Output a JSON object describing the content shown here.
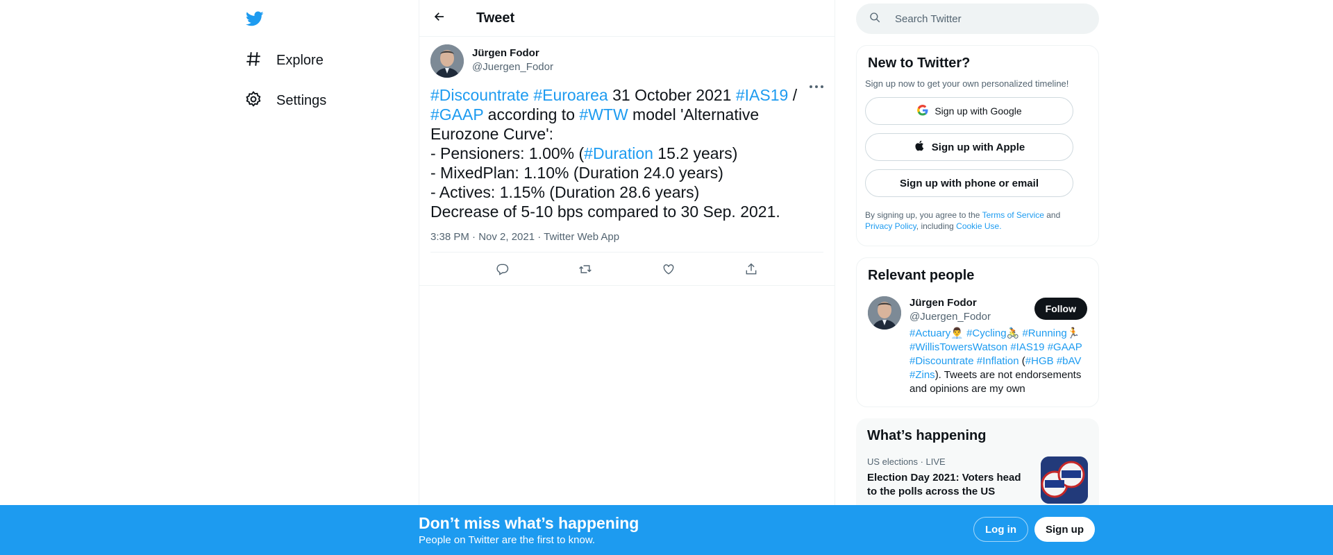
{
  "colors": {
    "accent": "#1d9bf0",
    "text": "#0f1419",
    "muted": "#536471",
    "border": "#eff3f4"
  },
  "nav": {
    "logo_icon": "twitter-bird-icon",
    "items": [
      {
        "label": "Explore",
        "icon": "hashtag-icon"
      },
      {
        "label": "Settings",
        "icon": "gear-icon"
      }
    ]
  },
  "header": {
    "title": "Tweet",
    "back_icon": "arrow-left-icon"
  },
  "tweet": {
    "author_name": "Jürgen Fodor",
    "author_handle": "@Juergen_Fodor",
    "text_segments": [
      {
        "t": "#Discountrate",
        "tag": true
      },
      {
        "t": " ",
        "tag": false
      },
      {
        "t": "#Euroarea",
        "tag": true
      },
      {
        "t": " 31 October 2021 ",
        "tag": false
      },
      {
        "t": "#IAS19",
        "tag": true
      },
      {
        "t": " /\n",
        "tag": false
      },
      {
        "t": "#GAAP",
        "tag": true
      },
      {
        "t": " according to ",
        "tag": false
      },
      {
        "t": "#WTW",
        "tag": true
      },
      {
        "t": " model 'Alternative\nEurozone Curve':\n- Pensioners: 1.00% (",
        "tag": false
      },
      {
        "t": "#Duration",
        "tag": true
      },
      {
        "t": " 15.2 years)\n- MixedPlan: 1.10% (Duration 24.0 years)\n- Actives: 1.15% (Duration 28.6 years)\nDecrease of 5-10 bps compared to 30 Sep. 2021.",
        "tag": false
      }
    ],
    "meta": "3:38 PM · Nov 2, 2021 · Twitter Web App",
    "actions": [
      "reply-icon",
      "retweet-icon",
      "like-icon",
      "share-icon"
    ]
  },
  "search": {
    "placeholder": "Search Twitter"
  },
  "new_to_twitter": {
    "title": "New to Twitter?",
    "subtitle": "Sign up now to get your own personalized timeline!",
    "google_label": "Sign up with Google",
    "apple_label": "Sign up with Apple",
    "phone_label": "Sign up with phone or email",
    "terms_prefix": "By signing up, you agree to the ",
    "terms_link": "Terms of Service",
    "terms_and": " and",
    "privacy_link": "Privacy Policy",
    "terms_including": ", including ",
    "cookie_link": "Cookie Use."
  },
  "relevant_people": {
    "title": "Relevant people",
    "name": "Jürgen Fodor",
    "handle": "@Juergen_Fodor",
    "follow_label": "Follow",
    "bio_segments": [
      {
        "t": "#Actuary",
        "tag": true
      },
      {
        "t": "👨‍💼 ",
        "tag": false
      },
      {
        "t": "#Cycling",
        "tag": true
      },
      {
        "t": "🚴 ",
        "tag": false
      },
      {
        "t": "#Running",
        "tag": true
      },
      {
        "t": "🏃 ",
        "tag": false
      },
      {
        "t": "#WillisTowersWatson",
        "tag": true
      },
      {
        "t": " ",
        "tag": false
      },
      {
        "t": "#IAS19",
        "tag": true
      },
      {
        "t": " ",
        "tag": false
      },
      {
        "t": "#GAAP",
        "tag": true
      },
      {
        "t": " ",
        "tag": false
      },
      {
        "t": "#Discountrate",
        "tag": true
      },
      {
        "t": " ",
        "tag": false
      },
      {
        "t": "#Inflation",
        "tag": true
      },
      {
        "t": " (",
        "tag": false
      },
      {
        "t": "#HGB",
        "tag": true
      },
      {
        "t": " ",
        "tag": false
      },
      {
        "t": "#bAV",
        "tag": true
      },
      {
        "t": " ",
        "tag": false
      },
      {
        "t": "#Zins",
        "tag": true
      },
      {
        "t": "). Tweets are not endorsements and opinions are my own",
        "tag": false
      }
    ]
  },
  "happening": {
    "title": "What’s happening",
    "trend_category": "US elections",
    "trend_live": "LIVE",
    "trend_title": "Election Day 2021: Voters head to the polls across the US"
  },
  "banner": {
    "title": "Don’t miss what’s happening",
    "subtitle": "People on Twitter are the first to know.",
    "login_label": "Log in",
    "signup_label": "Sign up"
  }
}
